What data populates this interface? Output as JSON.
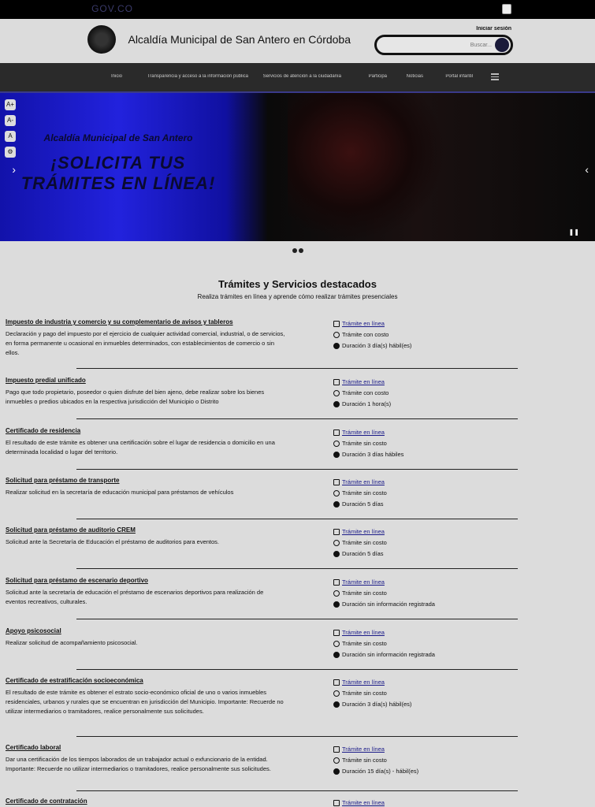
{
  "topbar": {
    "govco_label": "GOV.CO"
  },
  "header": {
    "site_title": "Alcaldía Municipal de San Antero en Córdoba",
    "search_label": "Iniciar sesión",
    "search_placeholder": "Buscar..."
  },
  "nav": {
    "items": [
      "Inicio",
      "Transparencia y acceso a la información pública",
      "Servicios de atención a la ciudadanía",
      "Participa",
      "Noticias",
      "Portal infantil"
    ]
  },
  "hero": {
    "line1": "Alcaldía Municipal de San Antero",
    "line2": "¡SOLICITA TUS TRÁMITES EN LÍNEA!"
  },
  "accessibility": {
    "buttons": [
      "A+",
      "A-",
      "A",
      "⚙"
    ]
  },
  "section": {
    "title": "Trámites y Servicios destacados",
    "subtitle": "Realiza trámites en línea y aprende cómo realizar trámites presenciales"
  },
  "items": [
    {
      "title": "Impuesto de industria y comercio y su complementario de avisos y tableros",
      "desc": "Declaración y pago del impuesto por el ejercicio de cualquier actividad comercial, industrial, o de servicios, en forma permanente u ocasional en inmuebles determinados, con establecimientos de comercio o sin ellos.",
      "mode": "Trámite en línea",
      "cost": "Trámite con costo",
      "duration": "Duración 3 día(s) hábil(es)"
    },
    {
      "title": "Impuesto predial unificado",
      "desc": "Pago que todo propietario, poseedor o quien disfrute del bien ajeno, debe realizar sobre los bienes inmuebles o predios ubicados en la respectiva jurisdicción del Municipio o Distrito",
      "mode": "Trámite en línea",
      "cost": "Trámite con costo",
      "duration": "Duración 1 hora(s)"
    },
    {
      "title": "Certificado de residencia",
      "desc": "El resultado de este trámite es obtener una certificación sobre el lugar de residencia o domicilio en una determinada localidad o lugar del territorio.",
      "mode": "Trámite en línea",
      "cost": "Trámite sin costo",
      "duration": "Duración 3 días hábiles"
    },
    {
      "title": "Solicitud para préstamo de transporte",
      "desc": "Realizar solicitud en la secretaría de educación municipal para préstamos de vehículos",
      "mode": "Trámite en línea",
      "cost": "Trámite sin costo",
      "duration": "Duración 5 días"
    },
    {
      "title": "Solicitud para préstamo de auditorio CREM",
      "desc": "Solicitud ante la Secretaría de Educación el préstamo de auditorios para eventos.",
      "mode": "Trámite en línea",
      "cost": "Trámite sin costo",
      "duration": "Duración 5 días"
    },
    {
      "title": "Solicitud para préstamo de escenario deportivo",
      "desc": "Solicitud ante la secretaría de educación el préstamo de escenarios deportivos para realización de eventos recreativos, culturales.",
      "mode": "Trámite en línea",
      "cost": "Trámite sin costo",
      "duration": "Duración sin información registrada"
    },
    {
      "title": "Apoyo psicosocial",
      "desc": "Realizar solicitud de acompañamiento psicosocial.",
      "mode": "Trámite en línea",
      "cost": "Trámite sin costo",
      "duration": "Duración sin información registrada"
    },
    {
      "title": "Certificado de estratificación socioeconómica",
      "desc": "El resultado de este trámite es obtener el estrato socio-económico oficial de uno o varios inmuebles residenciales, urbanos y rurales que se encuentran en jurisdicción del Municipio. Importante: Recuerde no utilizar intermediarios o tramitadores, realice personalmente sus solicitudes.",
      "mode": "Trámite en línea",
      "cost": "Trámite sin costo",
      "duration": "Duración 3 día(s) hábil(es)"
    },
    {
      "title": "Certificado laboral",
      "desc": "Dar una certificación de los tiempos laborados de un trabajador actual o exfuncionario de la entidad. Importante: Recuerde no utilizar intermediarios o tramitadores, realice personalmente sus solicitudes.",
      "mode": "Trámite en línea",
      "cost": "Trámite sin costo",
      "duration": "Duración 15 día(s) - hábil(es)"
    },
    {
      "title": "Certificado de contratación",
      "desc": "",
      "mode": "Trámite en línea",
      "cost": "",
      "duration": ""
    }
  ]
}
